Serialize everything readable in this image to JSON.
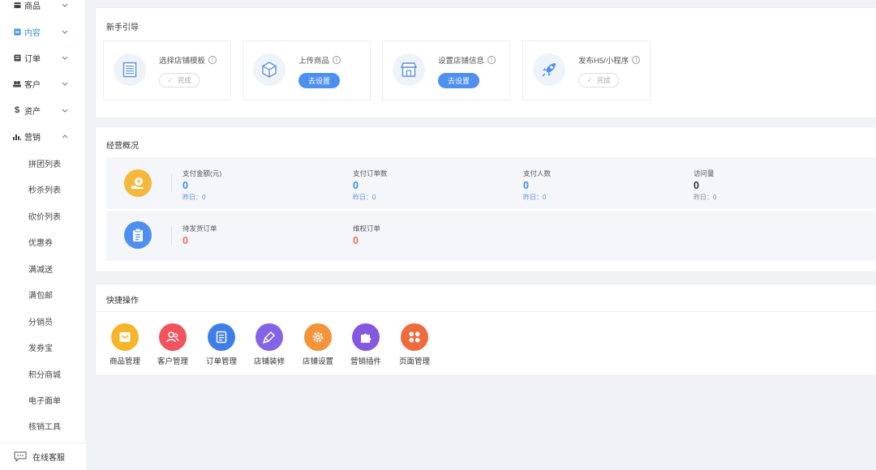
{
  "sidebar": {
    "menu": [
      {
        "label": "商品",
        "icon": "box-icon"
      },
      {
        "label": "内容",
        "icon": "content-icon",
        "active": true
      },
      {
        "label": "订单",
        "icon": "order-icon"
      },
      {
        "label": "客户",
        "icon": "customer-icon"
      },
      {
        "label": "资产",
        "icon": "dollar-icon"
      },
      {
        "label": "营销",
        "icon": "chart-icon",
        "expanded": true
      }
    ],
    "submenu": [
      "拼团列表",
      "秒杀列表",
      "砍价列表",
      "优惠券",
      "满减送",
      "满包邮",
      "分销员",
      "发券宝",
      "积分商城",
      "电子面单",
      "核销工具"
    ],
    "support_label": "在线客服"
  },
  "guide": {
    "title": "新手引导",
    "items": [
      {
        "label": "选择店铺模板",
        "status": "完成",
        "icon": "template-icon"
      },
      {
        "label": "上传商品",
        "action": "去设置",
        "icon": "cube-icon"
      },
      {
        "label": "设置店铺信息",
        "action": "去设置",
        "icon": "store-icon"
      },
      {
        "label": "发布H5/小程序",
        "status": "完成",
        "icon": "rocket-icon"
      }
    ]
  },
  "overview": {
    "title": "经营概况",
    "row1": [
      {
        "label": "支付金额(元)",
        "value": "0",
        "yesterday": "昨日：0"
      },
      {
        "label": "支付订单数",
        "value": "0",
        "yesterday": "昨日：0"
      },
      {
        "label": "支付人数",
        "value": "0",
        "yesterday": "昨日：0"
      },
      {
        "label": "访问量",
        "value": "0",
        "yesterday": "昨日：0"
      }
    ],
    "row2": [
      {
        "label": "待发货订单",
        "value": "0"
      },
      {
        "label": "维权订单",
        "value": "0"
      }
    ]
  },
  "quick": {
    "title": "快捷操作",
    "items": [
      {
        "label": "商品管理",
        "color": "#f7b52b"
      },
      {
        "label": "客户管理",
        "color": "#f0555e"
      },
      {
        "label": "订单管理",
        "color": "#3f7ee8"
      },
      {
        "label": "店铺装修",
        "color": "#8463e8"
      },
      {
        "label": "店铺设置",
        "color": "#f5933a"
      },
      {
        "label": "营销插件",
        "color": "#8458e0"
      },
      {
        "label": "页面管理",
        "color": "#ef6a3c"
      }
    ]
  },
  "colors": {
    "accent": "#3a8ee6",
    "primary_button": "#4f8ff0",
    "value_blue": "#3a8ee6",
    "value_red": "#ef6b6b",
    "yesterday_blue": "#5a8fe0"
  }
}
